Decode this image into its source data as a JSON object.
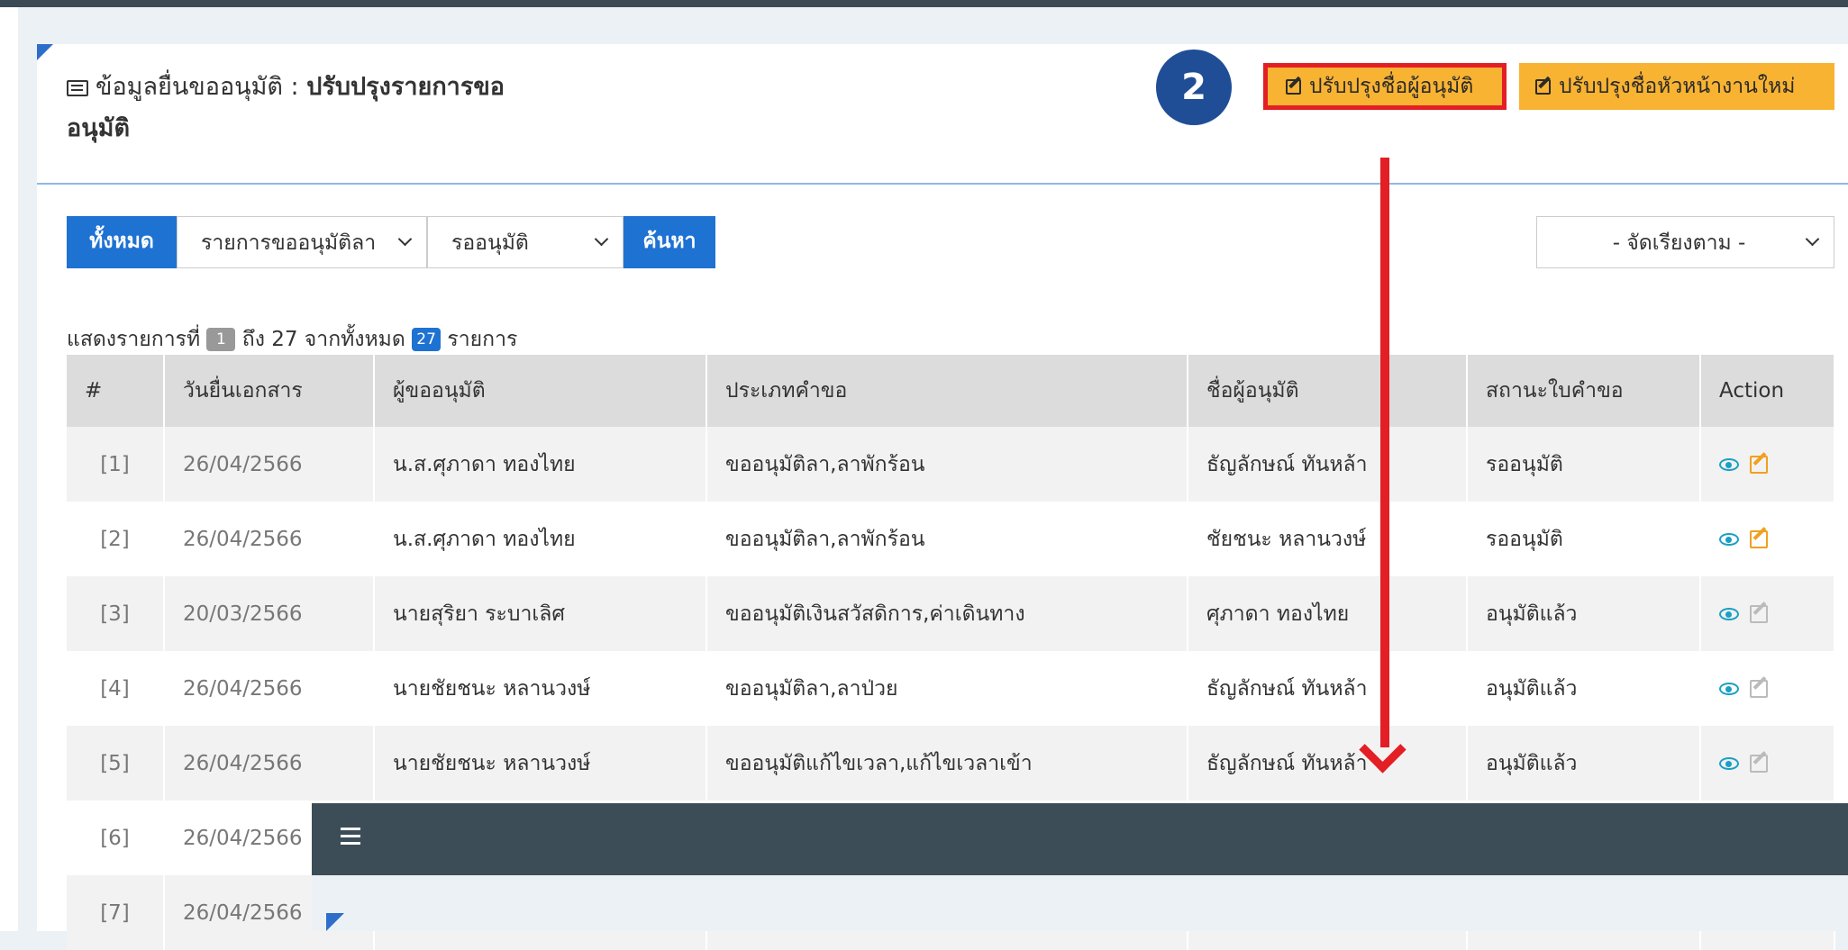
{
  "panel": {
    "title_prefix": "ข้อมูลยื่นขออนุมัติ : ",
    "title_bold": "ปรับปรุงรายการขอ",
    "title_bold_line2": "อนุมัติ"
  },
  "step_badge": "2",
  "buttons": {
    "update_approver": "ปรับปรุงชื่อผู้อนุมัติ",
    "update_head": "ปรับปรุงชื่อหัวหน้างานใหม่"
  },
  "filters": {
    "all": "ทั้งหมด",
    "type_selected": "รายการขออนุมัติลา",
    "status_selected": "รออนุมัติ",
    "search": "ค้นหา",
    "sort_selected": "- จัดเรียงตาม -"
  },
  "summary": {
    "prefix": "แสดงรายการที่",
    "from": "1",
    "to_text": "ถึง 27 จากทั้งหมด",
    "total": "27",
    "suffix": "รายการ"
  },
  "table": {
    "headers": [
      "#",
      "วันยื่นเอกสาร",
      "ผู้ขออนุมัติ",
      "ประเภทคำขอ",
      "ชื่อผู้อนุมัติ",
      "สถานะใบคำขอ",
      "Action"
    ],
    "rows": [
      {
        "num": "[1]",
        "date": "26/04/2566",
        "requester": "น.ส.ศุภาดา ทองไทย",
        "type": "ขออนุมัติลา,ลาพักร้อน",
        "approver": "ธัญลักษณ์ ทันหล้า",
        "status": "รออนุมัติ",
        "editable": true
      },
      {
        "num": "[2]",
        "date": "26/04/2566",
        "requester": "น.ส.ศุภาดา ทองไทย",
        "type": "ขออนุมัติลา,ลาพักร้อน",
        "approver": "ชัยชนะ หลานวงษ์",
        "status": "รออนุมัติ",
        "editable": true
      },
      {
        "num": "[3]",
        "date": "20/03/2566",
        "requester": "นายสุริยา ระบาเลิศ",
        "type": "ขออนุมัติเงินสวัสดิการ,ค่าเดินทาง",
        "approver": "ศุภาดา ทองไทย",
        "status": "อนุมัติแล้ว",
        "editable": false
      },
      {
        "num": "[4]",
        "date": "26/04/2566",
        "requester": "นายชัยชนะ หลานวงษ์",
        "type": "ขออนุมัติลา,ลาป่วย",
        "approver": "ธัญลักษณ์ ทันหล้า",
        "status": "อนุมัติแล้ว",
        "editable": false
      },
      {
        "num": "[5]",
        "date": "26/04/2566",
        "requester": "นายชัยชนะ หลานวงษ์",
        "type": "ขออนุมัติแก้ไขเวลา,แก้ไขเวลาเข้า",
        "approver": "ธัญลักษณ์ ทันหล้า",
        "status": "อนุมัติแล้ว",
        "editable": false
      },
      {
        "num": "[6]",
        "date": "26/04/2566",
        "requester": "",
        "type": "",
        "approver": "",
        "status": "",
        "editable": false
      },
      {
        "num": "[7]",
        "date": "26/04/2566",
        "requester": "",
        "type": "",
        "approver": "",
        "status": "",
        "editable": false
      }
    ]
  },
  "colors": {
    "primary": "#1e72d2",
    "warning": "#f9b332",
    "highlight": "#e31e24",
    "overlay_bar": "#3d4d57"
  }
}
